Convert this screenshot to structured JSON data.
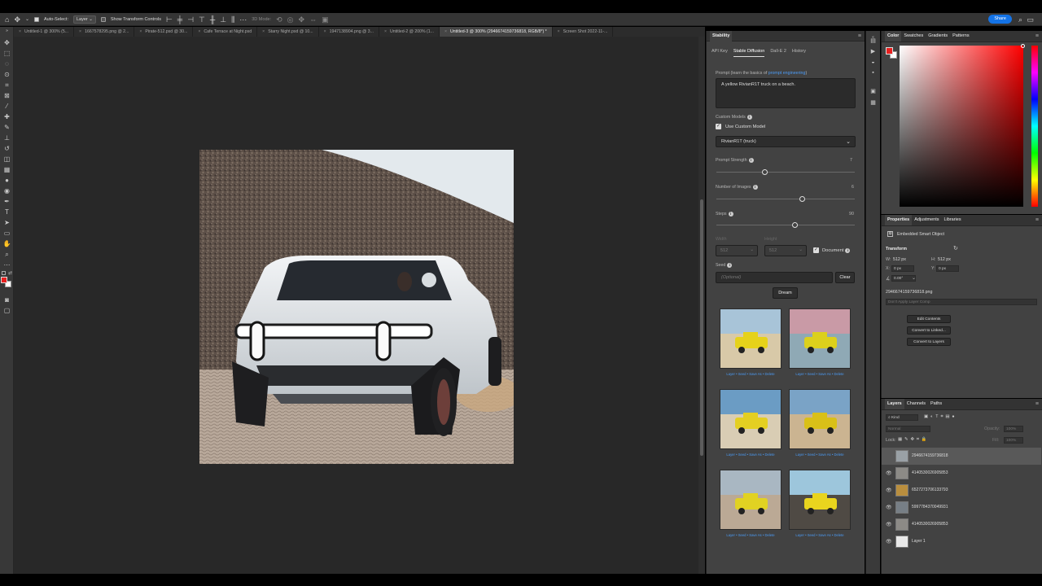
{
  "toolbar_top": {
    "auto_select_label": "Auto-Select:",
    "auto_select_value": "Layer",
    "transform_label": "Show Transform Controls",
    "mode_3d": "3D Mode:",
    "share": "Share"
  },
  "doc_tabs": [
    {
      "label": "Untitled-1 @ 300% (5...",
      "active": false
    },
    {
      "label": "1667578295.png @ 2...",
      "active": false
    },
    {
      "label": "Pirate-512.psd @ 30...",
      "active": false
    },
    {
      "label": "Cafe Terrace at Night.psd",
      "active": false
    },
    {
      "label": "Starry Night.psd @ 10...",
      "active": false
    },
    {
      "label": "1947138904.png @ 3...",
      "active": false
    },
    {
      "label": "Untitled-2 @ 200% (1...",
      "active": false
    },
    {
      "label": "Untitled-3 @ 300% (2946674159736818, RGB/8*) *",
      "active": true
    },
    {
      "label": "Screen Shot 2022-11-...",
      "active": false
    }
  ],
  "stability": {
    "panel_tab": "Stability",
    "tabs": [
      "API Key",
      "Stable Diffusion",
      "Dall-E 2",
      "History"
    ],
    "active_tab": "Stable Diffusion",
    "prompt_label": "Prompt (learn the basics of",
    "prompt_link": "prompt engineering",
    "prompt_close": ")",
    "prompt_value": "A yellow RivianR1T truck on a beach.",
    "custom_models_label": "Custom Models",
    "use_custom_model_label": "Use Custom Model",
    "use_custom_model_checked": true,
    "model_value": "RivianR1T (truck)",
    "prompt_strength_label": "Prompt Strength",
    "prompt_strength_value": "7",
    "prompt_strength_fraction": 0.35,
    "num_images_label": "Number of Images",
    "num_images_value": "6",
    "num_images_fraction": 0.62,
    "steps_label": "Steps",
    "steps_value": "90",
    "steps_fraction": 0.57,
    "width_label": "Width",
    "width_value": "512",
    "height_label": "Height",
    "height_value": "512",
    "document_label": "Document",
    "document_checked": true,
    "seed_label": "Seed",
    "seed_placeholder": "(Optional)",
    "clear_label": "Clear",
    "dream_label": "Dream",
    "result_link_layer": "Layer",
    "result_link_seed": "Seed",
    "result_link_saveas": "Save As",
    "result_link_delete": "Delete",
    "result_links_sep": " • "
  },
  "color_panel": {
    "tabs": [
      "Color",
      "Swatches",
      "Gradients",
      "Patterns"
    ],
    "foreground": "#e8201f",
    "background": "#ffffff"
  },
  "properties": {
    "tabs": [
      "Properties",
      "Adjustments",
      "Libraries"
    ],
    "object_type": "Embedded Smart Object",
    "transform_label": "Transform",
    "w_label": "W:",
    "w_value": "512 px",
    "h_label": "H:",
    "h_value": "512 px",
    "x_label": "X:",
    "x_value": "0 px",
    "y_label": "Y:",
    "y_value": "0 px",
    "angle_value": "0.00°",
    "filename": "2946674159736818.png",
    "layer_comp": "Don't Apply Layer Comp",
    "buttons": [
      "Edit Contents",
      "Convert to Linked...",
      "Convert to Layers"
    ]
  },
  "layers_panel": {
    "tabs": [
      "Layers",
      "Channels",
      "Paths"
    ],
    "filter": "Kind",
    "blend": "Normal",
    "opacity_label": "Opacity:",
    "opacity_value": "100%",
    "lock_label": "Lock:",
    "fill_label": "Fill:",
    "fill_value": "100%",
    "layers": [
      {
        "name": "2946674159736818",
        "visible": false,
        "selected": true
      },
      {
        "name": "4140530026905853",
        "visible": true,
        "selected": false
      },
      {
        "name": "6527273706133793",
        "visible": true,
        "selected": false
      },
      {
        "name": "5997784370049931",
        "visible": true,
        "selected": false
      },
      {
        "name": "4140530026905853",
        "visible": true,
        "selected": false
      },
      {
        "name": "Layer 1",
        "visible": true,
        "selected": false
      }
    ]
  }
}
